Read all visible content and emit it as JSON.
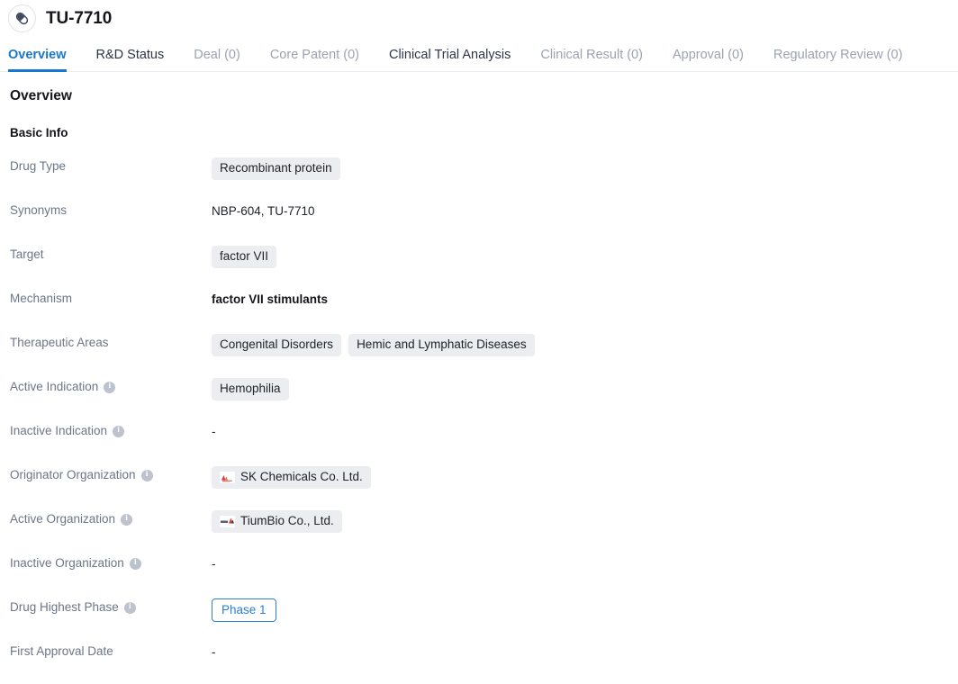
{
  "header": {
    "icon": "pill-capsule-icon",
    "title": "TU-7710"
  },
  "tabs": [
    {
      "label": "Overview",
      "state": "active"
    },
    {
      "label": "R&D Status",
      "state": "enabled"
    },
    {
      "label": "Deal (0)",
      "state": "disabled"
    },
    {
      "label": "Core Patent (0)",
      "state": "disabled"
    },
    {
      "label": "Clinical Trial Analysis",
      "state": "enabled"
    },
    {
      "label": "Clinical Result (0)",
      "state": "disabled"
    },
    {
      "label": "Approval (0)",
      "state": "disabled"
    },
    {
      "label": "Regulatory Review (0)",
      "state": "disabled"
    }
  ],
  "content": {
    "section_title": "Overview",
    "subsection_title": "Basic Info",
    "rows": [
      {
        "label": "Drug Type",
        "has_info": false,
        "type": "chips",
        "values": [
          "Recombinant protein"
        ]
      },
      {
        "label": "Synonyms",
        "has_info": false,
        "type": "text",
        "values": [
          "NBP-604,  TU-7710"
        ]
      },
      {
        "label": "Target",
        "has_info": false,
        "type": "chips",
        "values": [
          "factor VII"
        ]
      },
      {
        "label": "Mechanism",
        "has_info": false,
        "type": "text-bold",
        "values": [
          "factor VII stimulants"
        ]
      },
      {
        "label": "Therapeutic Areas",
        "has_info": false,
        "type": "chips",
        "values": [
          "Congenital Disorders",
          "Hemic and Lymphatic Diseases"
        ]
      },
      {
        "label": "Active Indication",
        "has_info": true,
        "type": "chips",
        "values": [
          "Hemophilia"
        ]
      },
      {
        "label": "Inactive Indication",
        "has_info": true,
        "type": "dash",
        "values": [
          "-"
        ]
      },
      {
        "label": "Originator Organization",
        "has_info": true,
        "type": "org-chips",
        "values": [
          "SK Chemicals Co. Ltd."
        ]
      },
      {
        "label": "Active Organization",
        "has_info": true,
        "type": "org-chips",
        "values": [
          "TiumBio Co., Ltd."
        ]
      },
      {
        "label": "Inactive Organization",
        "has_info": true,
        "type": "dash",
        "values": [
          "-"
        ]
      },
      {
        "label": "Drug Highest Phase",
        "has_info": true,
        "type": "phase",
        "values": [
          "Phase 1"
        ]
      },
      {
        "label": "First Approval Date",
        "has_info": false,
        "type": "dash",
        "values": [
          "-"
        ]
      }
    ]
  },
  "colors": {
    "accent": "#1877d2",
    "phase_badge": "#2b7fd4",
    "chip_bg": "#ebedf0",
    "label_text": "#6b7688",
    "value_text": "#20242c",
    "tab_disabled": "#9aa3b0"
  },
  "info_icon_glyph": "i"
}
